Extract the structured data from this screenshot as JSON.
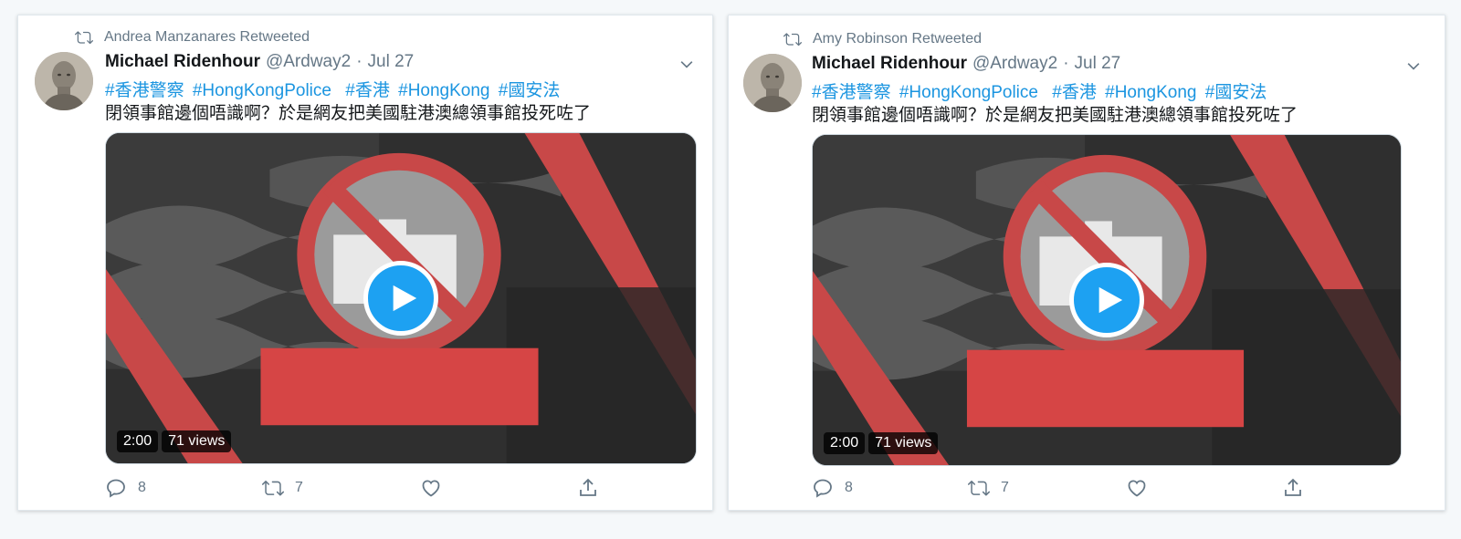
{
  "tweets": [
    {
      "retweeted_by": "Andrea Manzanares Retweeted",
      "author_name": "Michael Ridenhour",
      "handle": "@Ardway2",
      "separator": "·",
      "date": "Jul 27",
      "hashtags": [
        "#香港警察",
        "#HongKongPolice",
        "#香港",
        "#HongKong",
        "#國安法"
      ],
      "text": "閉領事館邊個唔識啊？於是網友把美國駐港澳總領事館投死咗了",
      "video_duration": "2:00",
      "video_views": "71 views",
      "replies": "8",
      "retweets": "7",
      "likes": ""
    },
    {
      "retweeted_by": "Amy Robinson Retweeted",
      "author_name": "Michael Ridenhour",
      "handle": "@Ardway2",
      "separator": "·",
      "date": "Jul 27",
      "hashtags": [
        "#香港警察",
        "#HongKongPolice",
        "#香港",
        "#HongKong",
        "#國安法"
      ],
      "text": "閉領事館邊個唔識啊？於是網友把美國駐港澳總領事館投死咗了",
      "video_duration": "2:00",
      "video_views": "71 views",
      "replies": "8",
      "retweets": "7",
      "likes": ""
    }
  ],
  "icons": {
    "retweet": "retweet-icon",
    "reply": "reply-icon",
    "like": "heart-icon",
    "share": "share-icon",
    "caret": "chevron-down-icon",
    "play": "play-icon"
  },
  "colors": {
    "link": "#1b95e0",
    "secondary_text": "#657786",
    "play_button": "#1da1f2",
    "overlay_red": "#d64545"
  }
}
